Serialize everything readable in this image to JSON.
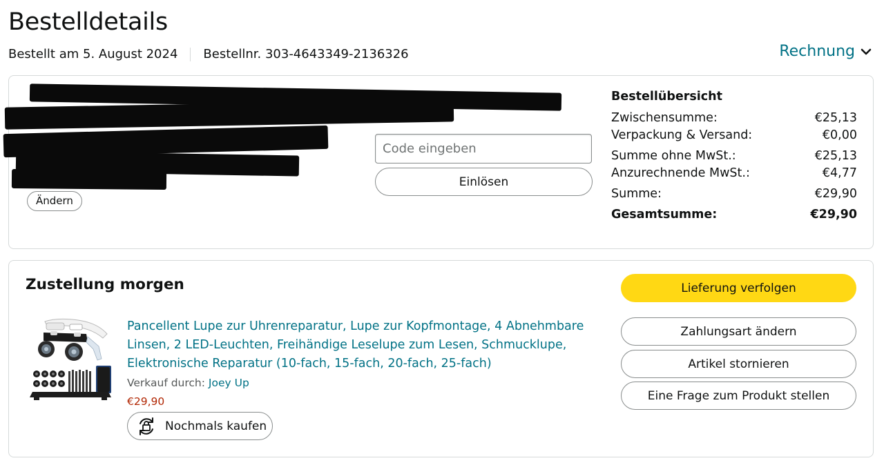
{
  "header": {
    "title": "Bestelldetails",
    "order_date": "Bestellt am 5. August 2024",
    "order_number": "Bestellnr. 303-4643349-2136326",
    "invoice_label": "Rechnung"
  },
  "payment": {
    "edit_label": "Ändern",
    "code_placeholder": "Code eingeben",
    "redeem_label": "Einlösen"
  },
  "summary": {
    "heading": "Bestellübersicht",
    "rows": [
      {
        "label": "Zwischensumme:",
        "value": "€25,13"
      },
      {
        "label": "Verpackung & Versand:",
        "value": "€0,00"
      },
      {
        "label": "Summe ohne MwSt.:",
        "value": "€25,13"
      },
      {
        "label": "Anzurechnende MwSt.:",
        "value": "€4,77"
      },
      {
        "label": "Summe:",
        "value": "€29,90"
      }
    ],
    "total": {
      "label": "Gesamtsumme:",
      "value": "€29,90"
    }
  },
  "delivery": {
    "title": "Zustellung morgen",
    "product": {
      "title": "Pancellent Lupe zur Uhrenreparatur, Lupe zur Kopfmontage, 4 Abnehmbare Linsen, 2 LED-Leuchten, Freihändige Leselupe zum Lesen, Schmucklupe, Elektronische Reparatur (10-fach, 15-fach, 20-fach, 25-fach)",
      "seller_prefix": "Verkauf durch:",
      "seller_name": "Joey Up",
      "price": "€29,90",
      "buy_again_label": "Nochmals kaufen"
    },
    "actions": {
      "track": "Lieferung verfolgen",
      "change_payment": "Zahlungsart ändern",
      "cancel": "Artikel stornieren",
      "ask": "Eine Frage zum Produkt stellen"
    }
  },
  "colors": {
    "link": "#007185",
    "price": "#b12704",
    "primary_button": "#ffd814",
    "border": "#d5d9d9"
  }
}
